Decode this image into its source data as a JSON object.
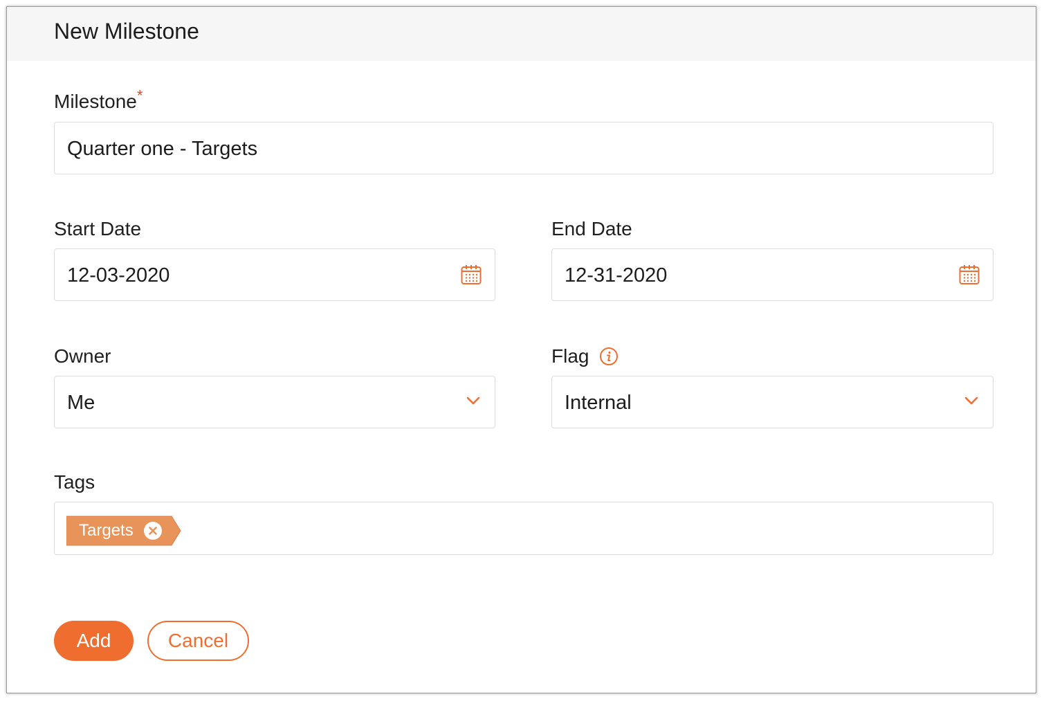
{
  "dialog": {
    "title": "New Milestone"
  },
  "form": {
    "milestone": {
      "label": "Milestone",
      "required_mark": "*",
      "value": "Quarter one - Targets"
    },
    "start_date": {
      "label": "Start Date",
      "value": "12-03-2020"
    },
    "end_date": {
      "label": "End Date",
      "value": "12-31-2020"
    },
    "owner": {
      "label": "Owner",
      "value": "Me"
    },
    "flag": {
      "label": "Flag",
      "value": "Internal"
    },
    "tags": {
      "label": "Tags",
      "items": [
        {
          "label": "Targets"
        }
      ]
    }
  },
  "actions": {
    "add_label": "Add",
    "cancel_label": "Cancel"
  },
  "icons": {
    "calendar": "calendar-icon",
    "chevron": "chevron-down-icon",
    "info": "info-icon",
    "remove": "close-circle-icon"
  },
  "colors": {
    "accent": "#ef6e2f",
    "tag_background": "#e8935a",
    "required": "#e24a2b",
    "border": "#dcdcdc",
    "header_background": "#f6f6f6"
  }
}
